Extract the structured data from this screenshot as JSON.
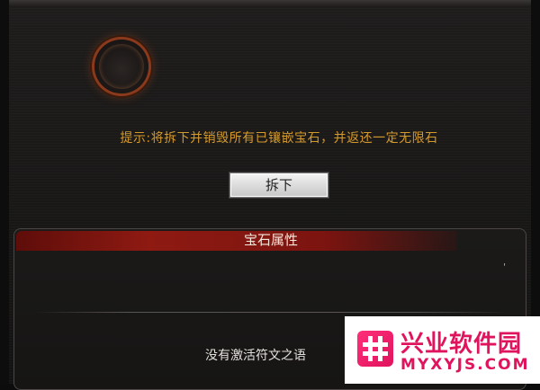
{
  "dialog": {
    "hint_text": "提示:将拆下并销毁所有已镶嵌宝石，并返还一定无限石",
    "remove_button_label": "拆下"
  },
  "attributes": {
    "title": "宝石属性",
    "mark": "'",
    "empty_rune_text": "没有激活符文之语"
  },
  "watermark": {
    "name": "兴业软件园",
    "url": "MYXYJS.COM"
  },
  "colors": {
    "hint": "#d49a2c",
    "header_red": "#8e1a12",
    "watermark_pink": "#e0135d"
  }
}
